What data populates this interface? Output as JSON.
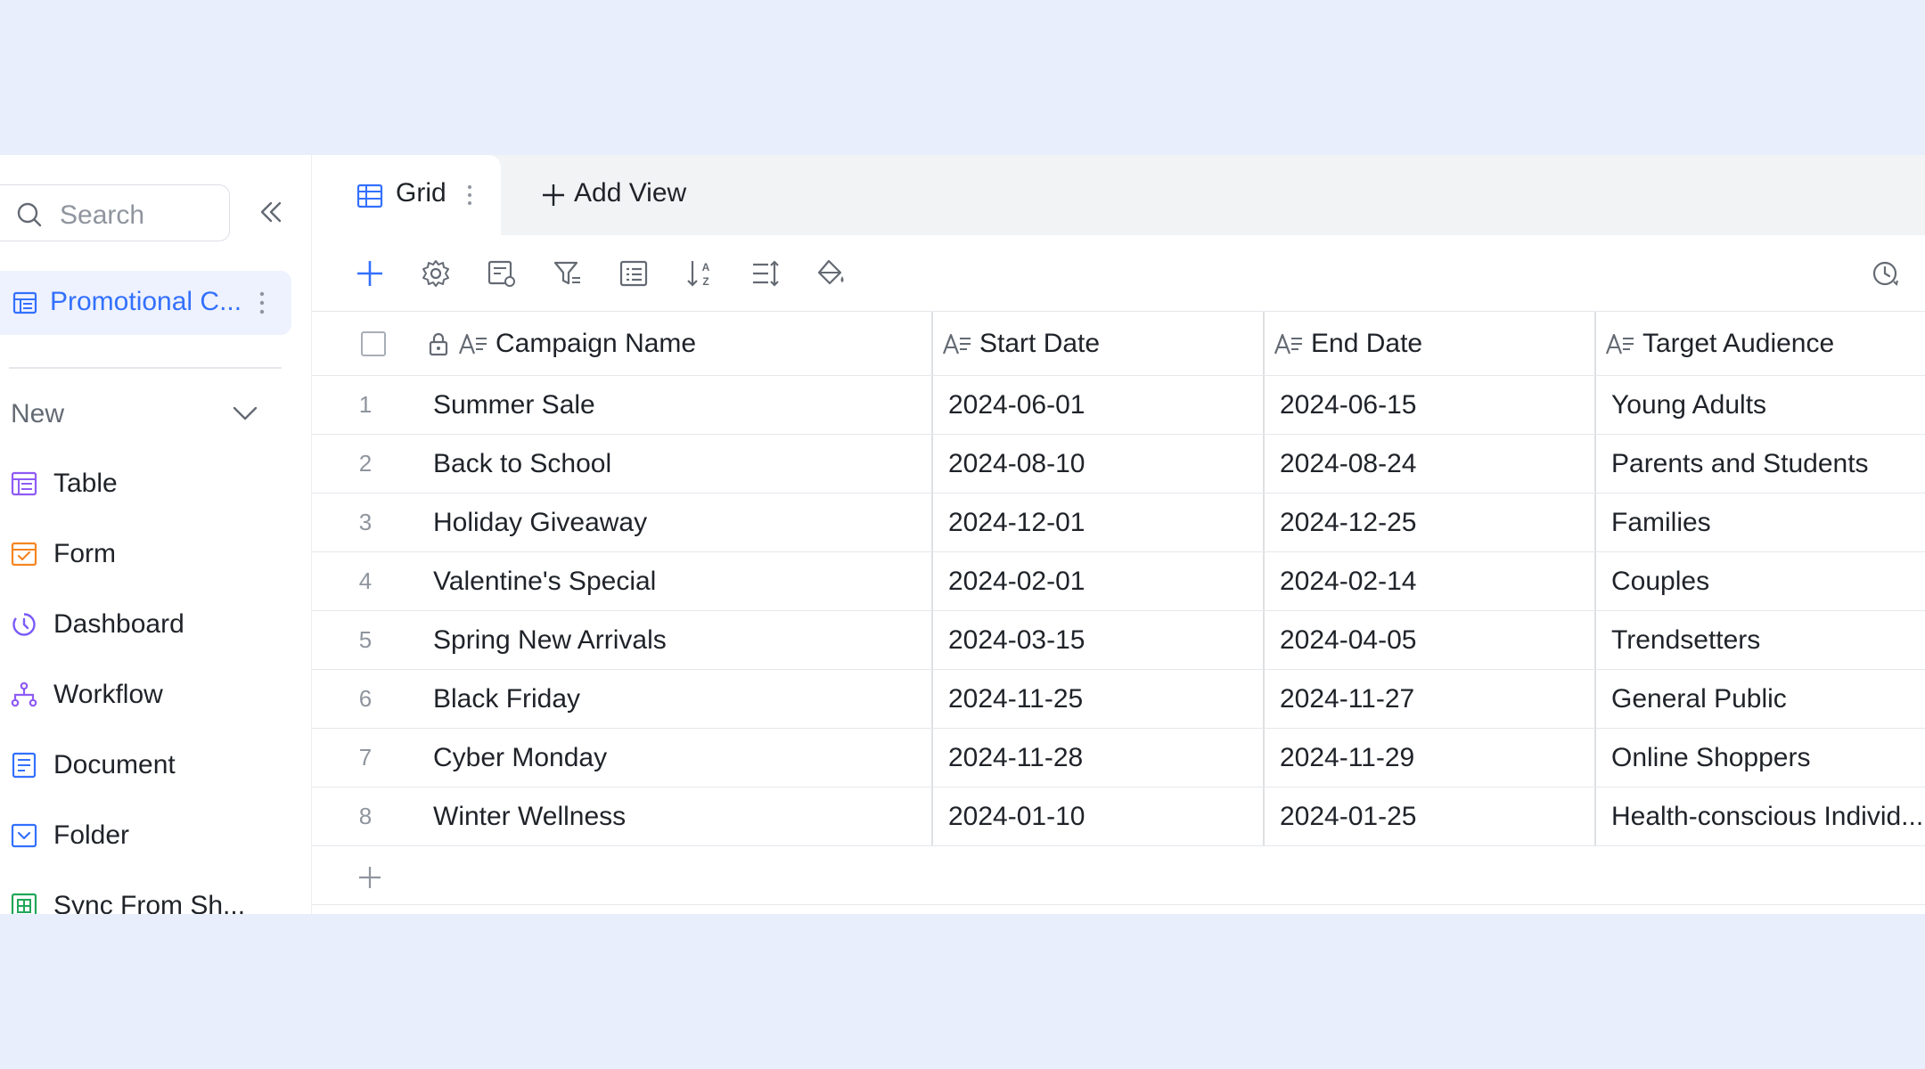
{
  "sidebar": {
    "search_placeholder": "Search",
    "project_label": "Promotional C...",
    "new_label": "New",
    "nav": [
      {
        "label": "Table",
        "icon": "table-icon",
        "color": "#8e5bf5"
      },
      {
        "label": "Form",
        "icon": "form-icon",
        "color": "#f5851f"
      },
      {
        "label": "Dashboard",
        "icon": "dashboard-icon",
        "color": "#7a5af8"
      },
      {
        "label": "Workflow",
        "icon": "workflow-icon",
        "color": "#8e5bf5"
      },
      {
        "label": "Document",
        "icon": "document-icon",
        "color": "#3370ff"
      },
      {
        "label": "Folder",
        "icon": "folder-icon",
        "color": "#3370ff"
      },
      {
        "label": "Sync From Sh...",
        "icon": "sheet-icon",
        "color": "#21a759"
      }
    ]
  },
  "tabs": {
    "grid_label": "Grid",
    "add_view_label": "Add View"
  },
  "toolbar": {
    "icons": [
      "add-record-icon",
      "settings-icon",
      "field-config-icon",
      "filter-icon",
      "group-icon",
      "sort-icon",
      "row-height-icon",
      "fill-color-icon",
      "history-icon"
    ]
  },
  "table": {
    "columns": [
      "Campaign Name",
      "Start Date",
      "End Date",
      "Target Audience"
    ],
    "rows": [
      {
        "num": "1",
        "cells": [
          "Summer Sale",
          "2024-06-01",
          "2024-06-15",
          "Young Adults"
        ]
      },
      {
        "num": "2",
        "cells": [
          "Back to School",
          "2024-08-10",
          "2024-08-24",
          "Parents and Students"
        ]
      },
      {
        "num": "3",
        "cells": [
          "Holiday Giveaway",
          "2024-12-01",
          "2024-12-25",
          "Families"
        ]
      },
      {
        "num": "4",
        "cells": [
          "Valentine's Special",
          "2024-02-01",
          "2024-02-14",
          "Couples"
        ]
      },
      {
        "num": "5",
        "cells": [
          "Spring New Arrivals",
          "2024-03-15",
          "2024-04-05",
          "Trendsetters"
        ]
      },
      {
        "num": "6",
        "cells": [
          "Black Friday",
          "2024-11-25",
          "2024-11-27",
          "General Public"
        ]
      },
      {
        "num": "7",
        "cells": [
          "Cyber Monday",
          "2024-11-28",
          "2024-11-29",
          "Online Shoppers"
        ]
      },
      {
        "num": "8",
        "cells": [
          "Winter Wellness",
          "2024-01-10",
          "2024-01-25",
          "Health-conscious Individ..."
        ]
      }
    ]
  },
  "colors": {
    "accent": "#3370ff",
    "selected_bg": "#eef2fe",
    "page_bg": "#e8eefc"
  }
}
